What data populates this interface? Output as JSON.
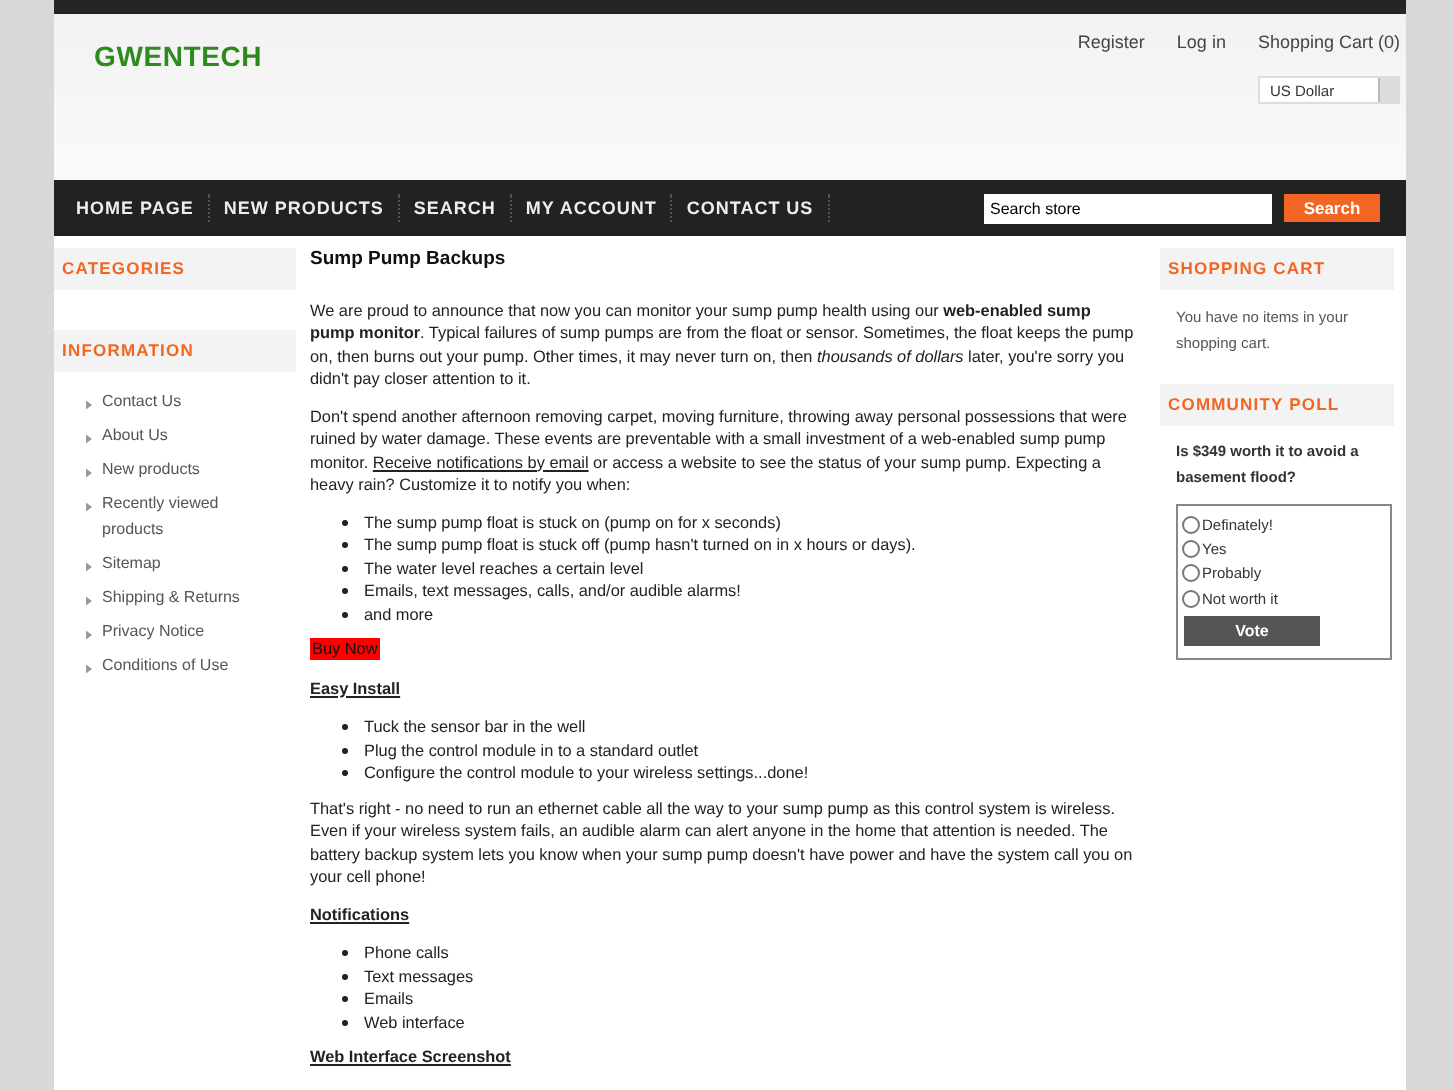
{
  "logo": "GWENTECH",
  "header_links": [
    "Register",
    "Log in",
    "Shopping Cart (0)"
  ],
  "currency": {
    "value": "US Dollar"
  },
  "nav": [
    "HOME PAGE",
    "NEW PRODUCTS",
    "SEARCH",
    "MY ACCOUNT",
    "CONTACT US"
  ],
  "search": {
    "value": "Search store",
    "button": "Search"
  },
  "left": {
    "categories_title": "CATEGORIES",
    "information_title": "INFORMATION",
    "links": [
      "Contact Us",
      "About Us",
      "New products",
      "Recently viewed products",
      "Sitemap",
      "Shipping & Returns",
      "Privacy Notice",
      "Conditions of Use"
    ]
  },
  "main": {
    "title": "Sump Pump Backups",
    "blocks": [
      {
        "kind": "paragraph",
        "text": "We are proud to announce that now you can monitor your sump pump health using our **web-enabled sump pump monitor**.  Typical failures of sump pumps are from the float or sensor.  Sometimes, the float keeps the pump on, then burns out your pump.  Other times, it may never turn on, then *thousands of dollars* later, you're sorry you didn't pay closer attention to it."
      },
      {
        "kind": "paragraph",
        "text": "Don't spend another afternoon removing carpet, moving furniture, throwing away personal possessions that were ruined by water damage.  These events are preventable with a small investment of a web-enabled sump pump monitor. ",
        "link": "Receive notifications by email",
        "after": " or access a website to see the status of your sump pump.  Expecting a heavy rain?  Customize it to notify you when:"
      },
      {
        "kind": "list",
        "items": [
          "The sump pump float is stuck on (pump on for x seconds)",
          "The sump pump float is stuck off (pump hasn't turned on in x hours or days).",
          "The water level reaches a certain level",
          "Emails, text messages, calls, and/or audible alarms!",
          "and more"
        ]
      },
      {
        "kind": "buy",
        "text": "Buy Now"
      },
      {
        "kind": "subheading",
        "text": "Easy Install"
      },
      {
        "kind": "list",
        "items": [
          "Tuck the sensor bar in the well",
          "Plug the control module in to a  standard outlet",
          "Configure the control module to your wireless settings...done!"
        ]
      },
      {
        "kind": "paragraph",
        "text": "That's right - no need to run an ethernet cable all the way to your sump pump as this control system is wireless.  Even if your wireless system fails, an audible alarm can alert anyone in the home that attention is needed.  The battery backup system lets you know when your sump pump doesn't have power and have the system call you on your cell phone!"
      },
      {
        "kind": "subheading",
        "text": "Notifications"
      },
      {
        "kind": "list",
        "items": [
          "Phone calls",
          "Text messages",
          "Emails",
          "Web interface"
        ]
      },
      {
        "kind": "subheading",
        "text": "Web Interface Screenshot"
      }
    ]
  },
  "right": {
    "cart_title": "SHOPPING CART",
    "cart_text": "You have no items in your shopping cart.",
    "poll_title": "COMMUNITY POLL",
    "question": "Is $349 worth it to avoid a basement flood?",
    "options": [
      {
        "label": "Definately!",
        "selected": false
      },
      {
        "label": "Yes",
        "selected": false
      },
      {
        "label": "Probably",
        "selected": false
      },
      {
        "label": "Not worth it",
        "selected": false
      }
    ],
    "vote": "Vote"
  }
}
